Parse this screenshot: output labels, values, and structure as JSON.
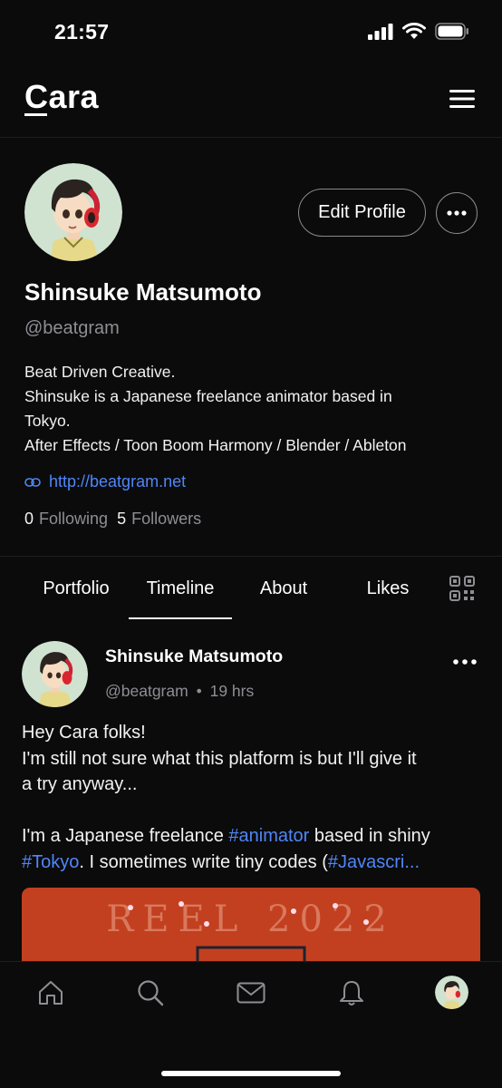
{
  "status_bar": {
    "time": "21:57"
  },
  "header": {
    "logo": "Cara",
    "menu_icon": "hamburger-menu-icon"
  },
  "profile": {
    "edit_label": "Edit Profile",
    "name": "Shinsuke Matsumoto",
    "handle": "@beatgram",
    "bio_lines": [
      "Beat Driven Creative.",
      "Shinsuke is a Japanese freelance animator based in",
      "Tokyo.",
      "After Effects / Toon Boom Harmony / Blender / Ableton"
    ],
    "website": "http://beatgram.net",
    "following_count": "0",
    "following_label": "Following",
    "followers_count": "5",
    "followers_label": "Followers"
  },
  "tabs": [
    "Portfolio",
    "Timeline",
    "About",
    "Likes"
  ],
  "active_tab": "Timeline",
  "post": {
    "author": "Shinsuke Matsumoto",
    "handle": "@beatgram",
    "separator": "•",
    "time": "19 hrs",
    "line1": "Hey Cara folks!",
    "line2": "I'm still not sure what this platform is but I'll give it",
    "line3": "a try anyway...",
    "line5_a": "I'm a Japanese freelance ",
    "tag_animator": "#animator",
    "line5_b": " based in shiny",
    "tag_tokyo": "#Tokyo",
    "line6_b": ". I sometimes write tiny codes (",
    "tag_js": "#Javascri...",
    "image_text": "REEL 2022"
  },
  "colors": {
    "background": "#0b0b0c",
    "link": "#4f86f7",
    "muted": "#8e8e93",
    "image_bg": "#c2401f"
  },
  "bottom_nav": {
    "icons": [
      "home-icon",
      "search-icon",
      "mail-icon",
      "bell-icon",
      "profile-avatar"
    ]
  }
}
